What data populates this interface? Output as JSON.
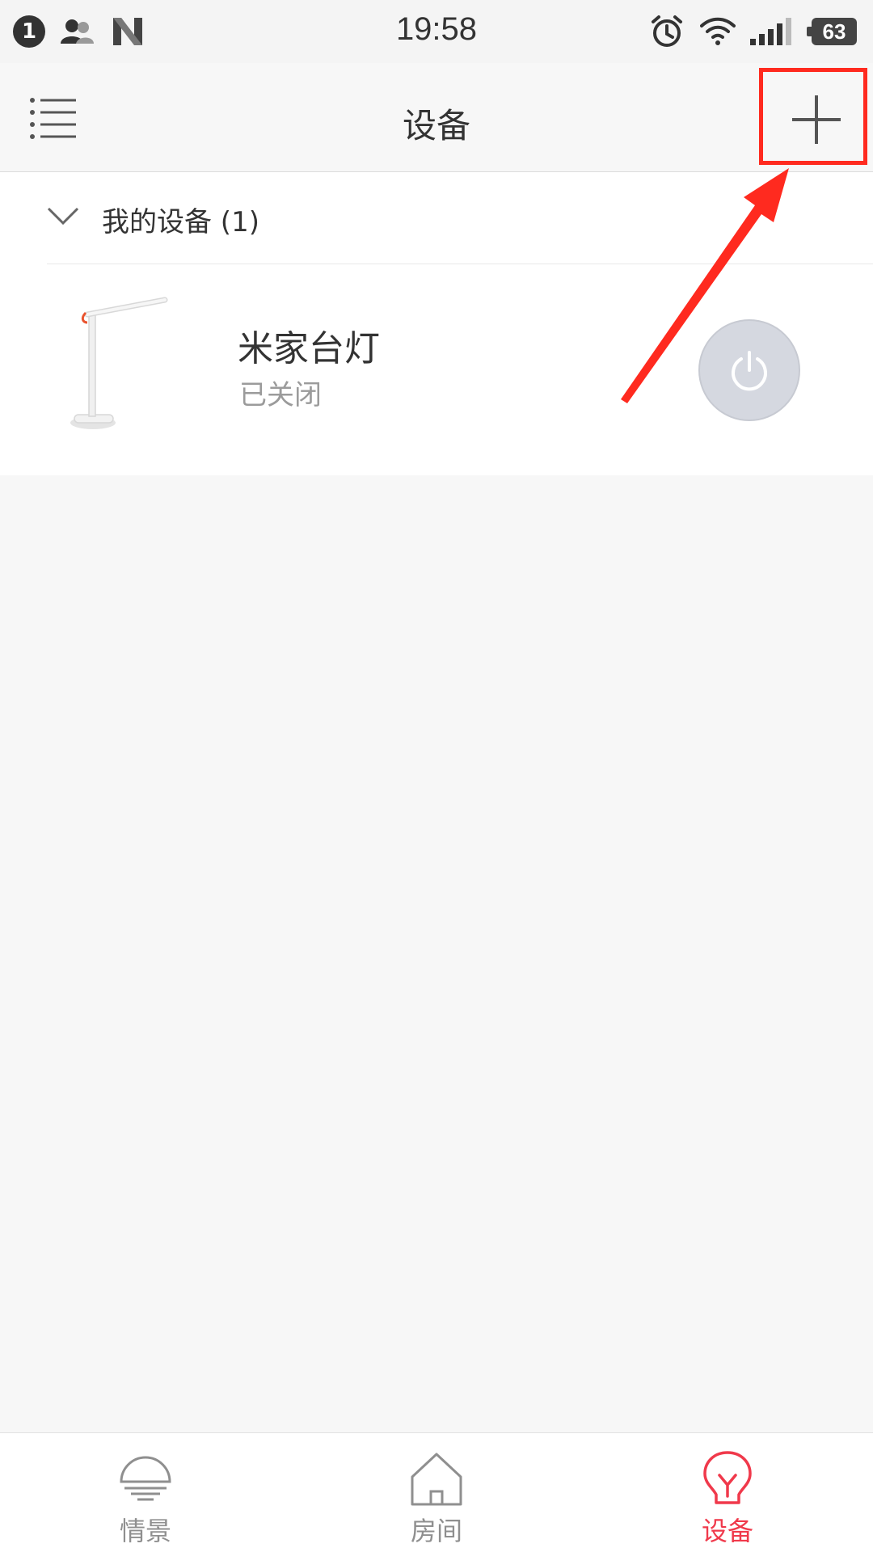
{
  "status_bar": {
    "notification_count": "1",
    "time": "19:58",
    "battery": "63",
    "icons": [
      "people-icon",
      "n-icon",
      "alarm-icon",
      "wifi-icon",
      "signal-icon",
      "battery-icon"
    ]
  },
  "header": {
    "title": "设备",
    "menu_icon": "list-icon",
    "add_icon": "plus-icon"
  },
  "device_group": {
    "label": "我的设备 (1)",
    "expanded": true
  },
  "devices": [
    {
      "name": "米家台灯",
      "status": "已关闭",
      "power_on": false,
      "image": "desk-lamp"
    }
  ],
  "bottom_nav": {
    "items": [
      {
        "label": "情景",
        "icon": "scene-light-icon",
        "active": false
      },
      {
        "label": "房间",
        "icon": "house-icon",
        "active": false
      },
      {
        "label": "设备",
        "icon": "bulb-icon",
        "active": true
      }
    ]
  },
  "colors": {
    "accent": "#f0394b",
    "annotation": "#ff2a1f",
    "background": "#f7f7f7"
  }
}
